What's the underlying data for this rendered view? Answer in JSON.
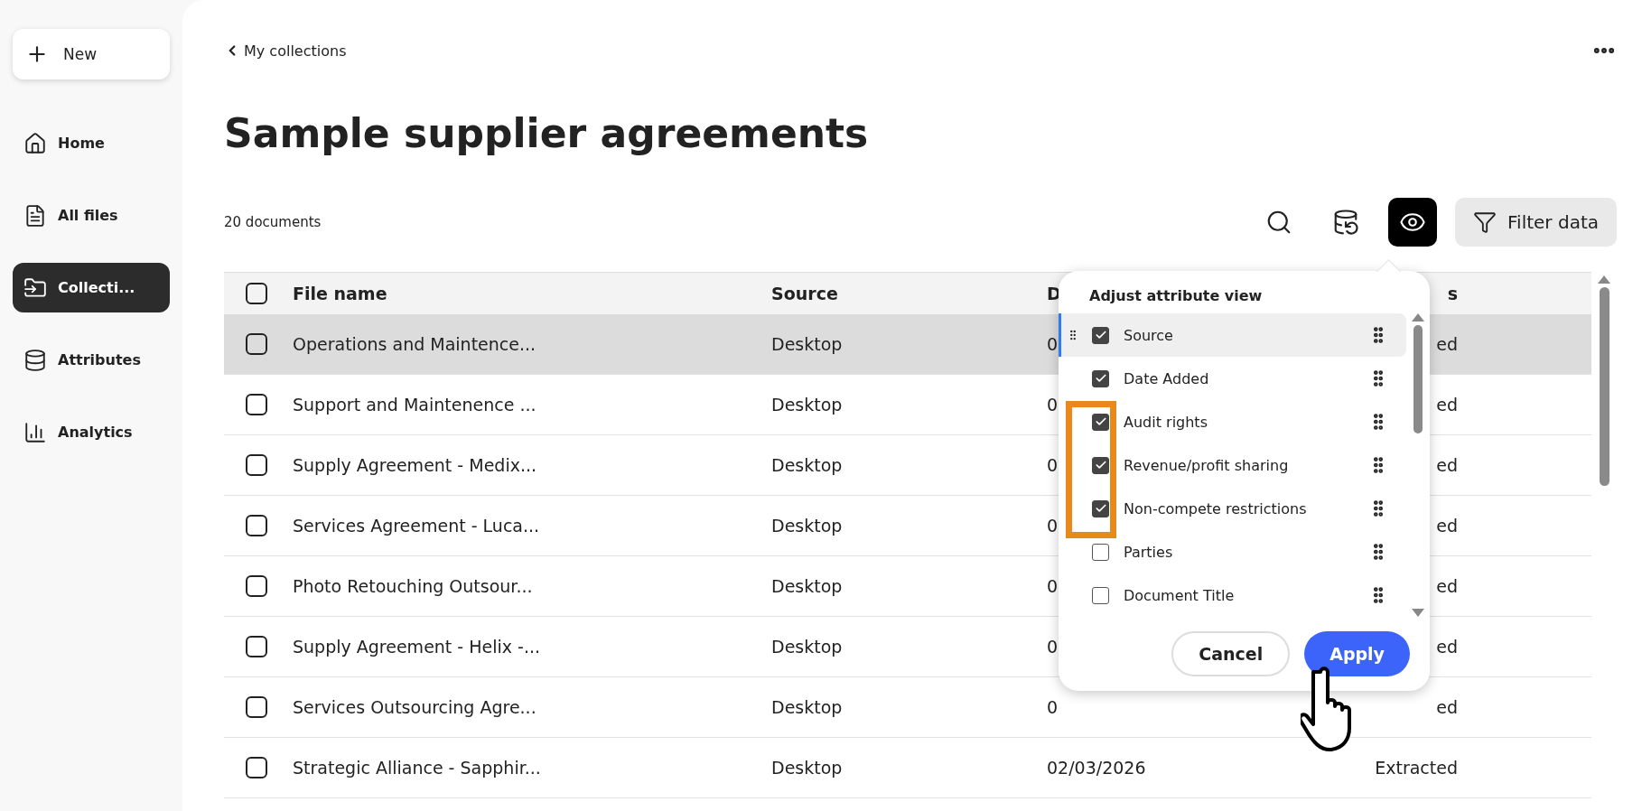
{
  "sidebar": {
    "new_button": "New",
    "items": [
      {
        "label": "Home",
        "selected": false
      },
      {
        "label": "All files",
        "selected": false
      },
      {
        "label": "Collecti...",
        "selected": true
      },
      {
        "label": "Attributes",
        "selected": false
      },
      {
        "label": "Analytics",
        "selected": false
      }
    ]
  },
  "breadcrumb": "My collections",
  "title": "Sample supplier agreements",
  "count": "20 documents",
  "toolbar": [
    {
      "kind": "search",
      "active": false
    },
    {
      "kind": "sync",
      "active": false
    },
    {
      "kind": "view",
      "active": true
    },
    {
      "kind": "filter",
      "label": "Filter data",
      "active": false
    }
  ],
  "table": {
    "select_all_checked": false,
    "columns": [
      "File name",
      "Source",
      "D",
      "s"
    ],
    "rows": [
      {
        "cells": [
          "Operations and Maintence...",
          "Desktop",
          "0",
          "ed"
        ],
        "checked": false,
        "selected": true
      },
      {
        "cells": [
          "Support and Maintenence ...",
          "Desktop",
          "0",
          "ed"
        ],
        "checked": false,
        "selected": false
      },
      {
        "cells": [
          "Supply Agreement - Medix...",
          "Desktop",
          "0",
          "ed"
        ],
        "checked": false,
        "selected": false
      },
      {
        "cells": [
          "Services Agreement - Luca...",
          "Desktop",
          "0",
          "ed"
        ],
        "checked": false,
        "selected": false
      },
      {
        "cells": [
          "Photo Retouching Outsour...",
          "Desktop",
          "0",
          "ed"
        ],
        "checked": false,
        "selected": false
      },
      {
        "cells": [
          "Supply Agreement - Helix -...",
          "Desktop",
          "0",
          "ed"
        ],
        "checked": false,
        "selected": false
      },
      {
        "cells": [
          "Services Outsourcing Agre...",
          "Desktop",
          "0",
          "ed"
        ],
        "checked": false,
        "selected": false
      },
      {
        "cells": [
          "Strategic Alliance - Sapphir...",
          "Desktop",
          "02/03/2026",
          "Extracted"
        ],
        "checked": false,
        "selected": false
      }
    ]
  },
  "popup": {
    "title": "Adjust attribute view",
    "items": [
      {
        "label": "Source",
        "checked": true,
        "selected": true
      },
      {
        "label": "Date Added",
        "checked": true,
        "selected": false
      },
      {
        "label": "Audit rights",
        "checked": true,
        "selected": false
      },
      {
        "label": "Revenue/profit sharing",
        "checked": true,
        "selected": false
      },
      {
        "label": "Non-compete restrictions",
        "checked": true,
        "selected": false
      },
      {
        "label": "Parties",
        "checked": false,
        "selected": false
      },
      {
        "label": "Document Title",
        "checked": false,
        "selected": false
      }
    ],
    "cancel": "Cancel",
    "apply": "Apply"
  }
}
